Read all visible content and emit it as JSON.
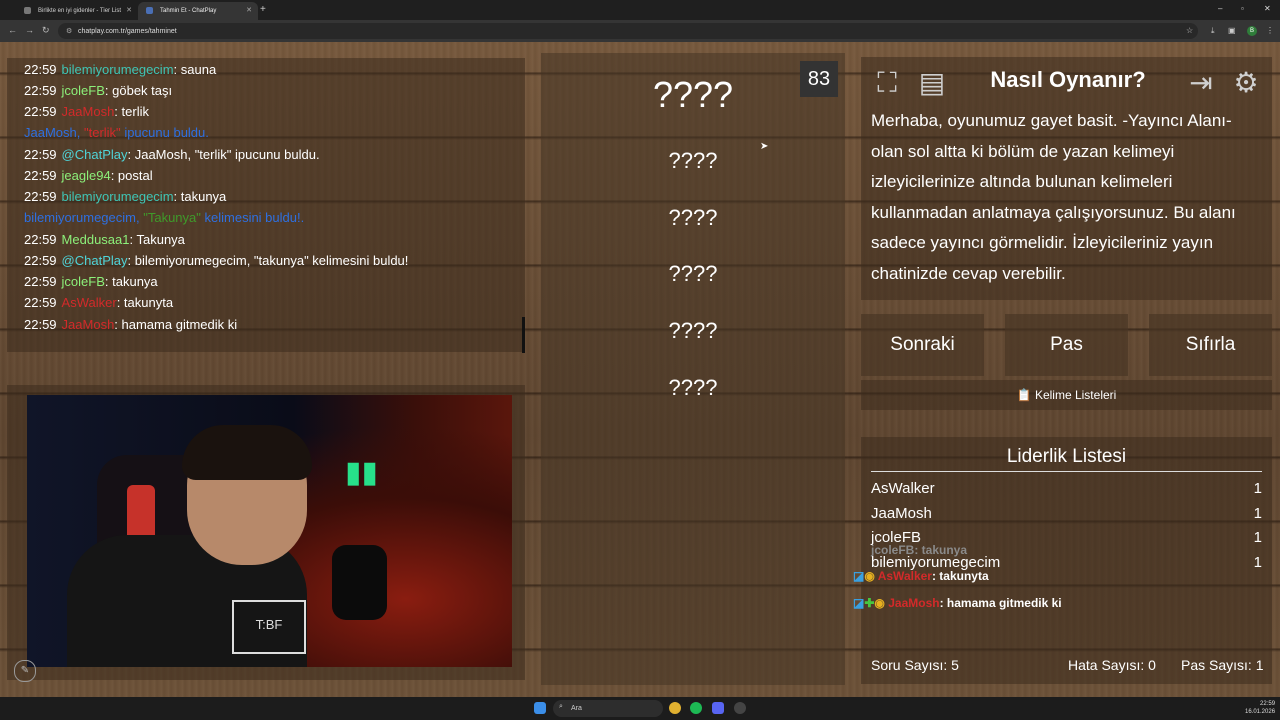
{
  "browser": {
    "tabs": [
      {
        "label": "Birlikte en iyi gidenler - Tier List"
      },
      {
        "label": "Tahmin Et - ChatPlay"
      }
    ],
    "url": "chatplay.com.tr/games/tahminet",
    "profile_initial": "B"
  },
  "chat": {
    "lines": [
      {
        "time": "22:59",
        "user": "bilemiyorumegecim",
        "msg": ": sauna"
      },
      {
        "time": "22:59",
        "user": "jcoleFB",
        "msg": ": göbek taşı"
      },
      {
        "time": "22:59",
        "user": "JaaMosh",
        "msg": ": terlik"
      },
      {
        "sys_user": "JaaMosh,",
        "sys_word": "\"terlik\"",
        "sys_msg": "ipucunu buldu."
      },
      {
        "time": "22:59",
        "user": "@ChatPlay",
        "msg": ": JaaMosh, \"terlik\" ipucunu buldu."
      },
      {
        "time": "22:59",
        "user": "jeagle94",
        "msg": ": postal"
      },
      {
        "time": "22:59",
        "user": "bilemiyorumegecim",
        "msg": ": takunya"
      },
      {
        "sys_user": "bilemiyorumegecim,",
        "sys_word": "\"Takunya\"",
        "sys_msg": "kelimesini buldu!."
      },
      {
        "time": "22:59",
        "user": "Meddusaa1",
        "msg": ": Takunya"
      },
      {
        "time": "22:59",
        "user": "@ChatPlay",
        "msg": ": bilemiyorumegecim, \"takunya\" kelimesini buldu!"
      },
      {
        "time": "22:59",
        "user": "jcoleFB",
        "msg": ": takunya"
      },
      {
        "time": "22:59",
        "user": "AsWalker",
        "msg": ": takunyta"
      },
      {
        "time": "22:59",
        "user": "JaaMosh",
        "msg": ": hamama gitmedik ki"
      }
    ]
  },
  "webcam": {
    "shirt_text": "T:BF"
  },
  "game": {
    "timer": "83",
    "hidden_words": [
      "????",
      "????",
      "????",
      "????",
      "????",
      "????"
    ]
  },
  "help": {
    "title": "Nasıl Oynanır?",
    "text": "Merhaba, oyunumuz gayet basit. -Yayıncı Alanı- olan sol altta ki bölüm de yazan kelimeyi izleyicilerinize altında bulunan kelimeleri kullanmadan anlatmaya çalışıyorsunuz. Bu alanı sadece yayıncı görmelidir. İzleyicileriniz yayın chatinizde cevap verebilir."
  },
  "controls": {
    "next": "Sonraki",
    "pass": "Pas",
    "reset": "Sıfırla",
    "word_lists": "Kelime Listeleri"
  },
  "leaderboard": {
    "title": "Liderlik Listesi",
    "rows": [
      {
        "name": "AsWalker",
        "score": "1"
      },
      {
        "name": "JaaMosh",
        "score": "1"
      },
      {
        "name": "jcoleFB",
        "score": "1"
      },
      {
        "name": "bilemiyorumegecim",
        "score": "1"
      }
    ],
    "overlay": [
      {
        "user": "jcoleFB",
        "msg": ": takunya"
      },
      {
        "user": "AsWalker",
        "msg": ": takunyta"
      },
      {
        "user": "JaaMosh",
        "msg": ": hamama gitmedik ki"
      }
    ]
  },
  "stats": {
    "questions_label": "Soru Sayısı:",
    "questions": "5",
    "errors_label": "Hata Sayısı:",
    "errors": "0",
    "passes_label": "Pas Sayısı:",
    "passes": "1"
  },
  "taskbar": {
    "search_placeholder": "Ara",
    "time": "22:59",
    "date": "16.01.2026"
  }
}
